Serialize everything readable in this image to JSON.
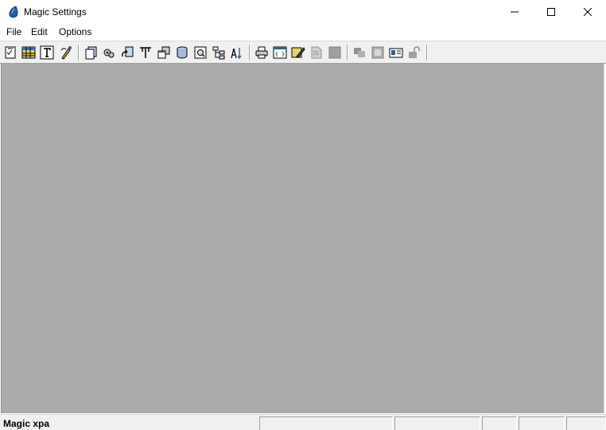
{
  "window": {
    "title": "Magic Settings",
    "icon": "magic-drop-icon",
    "controls": [
      "minimize",
      "maximize",
      "close"
    ]
  },
  "menu": {
    "items": [
      {
        "label": "File"
      },
      {
        "label": "Edit"
      },
      {
        "label": "Options"
      }
    ]
  },
  "toolbar": {
    "groups": [
      [
        "properties-icon",
        "table-grid-icon",
        "text-icon",
        "pen-brush-icon"
      ],
      [
        "copy-pages-icon",
        "gear-pages-icon",
        "refresh-pages-icon",
        "tree-branch-icon",
        "stacked-windows-icon",
        "cylinder-icon",
        "find-window-icon",
        "hierarchy-icon",
        "sort-az-icon"
      ],
      [
        "print-icon",
        "code-window-icon",
        "edit-form-icon",
        "document-gray-icon",
        "page-gray-icon"
      ],
      [
        "bring-front-icon",
        "frame-icon",
        "id-card-icon",
        "unlock-icon"
      ]
    ]
  },
  "status": {
    "text": "Magic xpa"
  },
  "colors": {
    "workspace": "#ababab",
    "chrome": "#f0f0f0",
    "accent_blue": "#1f5fa8"
  }
}
